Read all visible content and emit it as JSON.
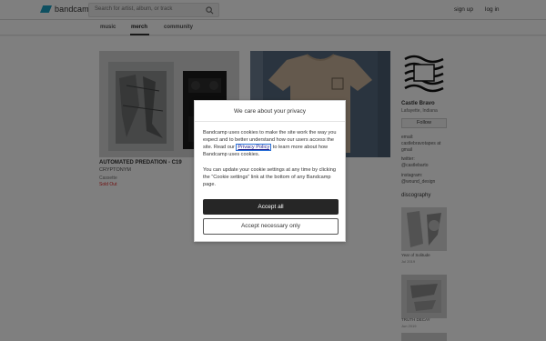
{
  "header": {
    "logo_text": "bandcamp",
    "search_placeholder": "Search for artist, album, or track",
    "signup": "sign up",
    "login": "log in"
  },
  "subnav": {
    "tabs": [
      "music",
      "merch",
      "community"
    ]
  },
  "merch": {
    "items": [
      {
        "title": "AUTOMATED PREDATION - C19",
        "artist": "CRYPTONYM",
        "type": "Cassette",
        "status": "Sold Out"
      }
    ]
  },
  "sidebar": {
    "artist_name": "Castle Bravo",
    "location": "Lafayette, Indiana",
    "follow": "Follow",
    "email_label": "email:",
    "email_value": "castlebravotapes at gmail",
    "twitter_label": "twitter:",
    "twitter_value": "@castlebarto",
    "instagram_label": "instagram:",
    "instagram_value": "@wound_design",
    "discography_heading": "discography",
    "discography": [
      {
        "title": "Year of Solitude",
        "date": "Jul 2019"
      },
      {
        "title": "TRUTH DECAY",
        "date": "Jun 2019"
      }
    ]
  },
  "modal": {
    "title": "We care about your privacy",
    "p1_before": "Bandcamp uses cookies to make the site work the way you expect and to better understand how our users access the site. Read our ",
    "p1_link": "Privacy Policy",
    "p1_after": " to learn more about how Bandcamp uses cookies.",
    "p2": "You can update your cookie settings at any time by clicking the “Cookie settings” link at the bottom of any Bandcamp page.",
    "accept_all": "Accept all",
    "accept_necessary": "Accept necessary only"
  },
  "colors": {
    "brand": "#1da0c3",
    "sold_out": "#dd2222",
    "overlay": "rgba(0,0,0,0.5)",
    "primary_button": "#262626"
  }
}
